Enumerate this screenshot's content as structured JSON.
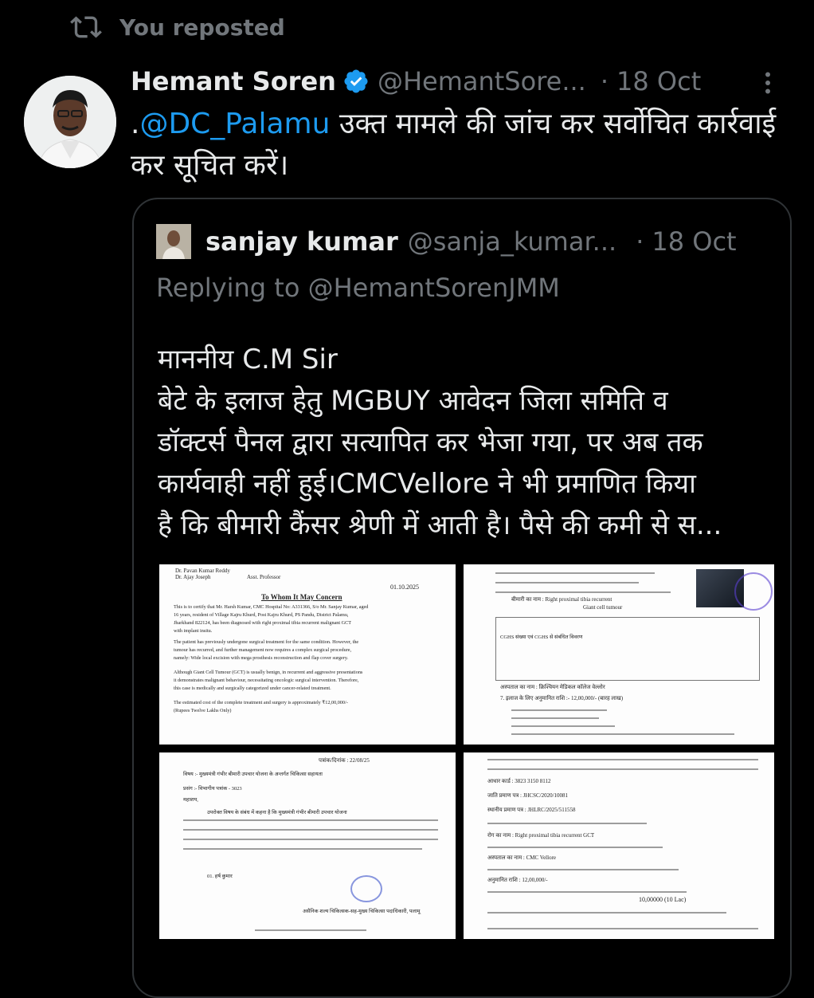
{
  "repost": {
    "label": "You reposted",
    "icon": "repost-icon"
  },
  "tweet": {
    "author_name": "Hemant Soren",
    "handle": "@HemantSore...",
    "separator": "·",
    "time": "18 Oct",
    "text_line1_prefix": ".",
    "mention": "@DC_Palamu",
    "text_line1_rest": " उक्त मामले की जांच कर सर्वोचित कार्रवाई",
    "text_line2": "कर सूचित करें।"
  },
  "quote": {
    "author_name": "sanjay kumar",
    "handle": "@sanja_kumar...",
    "separator": "·",
    "time": "18 Oct",
    "replying_to": "Replying to @HemantSorenJMM",
    "body": "माननीय C.M Sir\nबेटे के इलाज हेतु MGBUY आवेदन जिला समिति व\nडॉक्टर्स पैनल द्वारा सत्यापित कर भेजा गया, पर अब तक\nकार्यवाही नहीं हुई।CMCVellore ने भी प्रमाणित किया\nहै कि बीमारी कैंसर श्रेणी में आती है। पैसे की कमी से स..."
  },
  "doc1": {
    "date": "01.10.2025",
    "heading": "To Whom It May Concern",
    "l1": "This is to certify that Mr. Harsh Kumar, CMC Hospital No: A331366, S/o Mr. Sanjay Kumar, aged",
    "l2": "16 years, resident of Village Kajru Khurd, Post Kajru Khurd, PS Pandu, District Palamu,",
    "l3": "Jharkhand 822124, has been diagnosed with right proximal tibia recurrent malignant GCT",
    "l4": "with implant insitu.",
    "l5": "The patient has previously undergone surgical treatment for the same condition. However, the",
    "l6": "tumour has recurred, and further management now requires a complex surgical procedure,",
    "l7": "namely: Wide local excision with mega prosthesis reconstruction and flap cover surgery.",
    "l8": "Although Giant Cell Tumour (GCT) is usually benign, in recurrent and aggressive presentations",
    "l9": "it demonstrates malignant behaviour, necessitating oncologic surgical intervention. Therefore,",
    "l10": "this case is medically and surgically categorized under cancer-related treatment.",
    "l11": "The estimated cost of the complete treatment and surgery is approximately ₹12,00,000/-",
    "l12": "(Rupees Twelve Lakhs Only)",
    "h1": "Dr. Pavan Kumar Reddy",
    "h2": "Dr. Ajay Joseph",
    "h3": "Asst. Professor"
  },
  "doc2": {
    "l1": "बीमारी का नाम : Right proximal tibia recurrent",
    "l2": "Giant cell tumour",
    "l3": "CGHS संख्या एवं CGHS से संबंधित विवरण",
    "l4": "7. इलाज के लिए अनुमानित राशि :- 12,00,000/- (बारह लाख)",
    "l5": "अस्पताल का नाम : क्रिश्चियन मेडिकल कॉलेज वेल्लोर"
  },
  "doc3": {
    "l1": "पत्रांक/दिनांक : 22/08/25",
    "l2": "विषय :- मुख्यमंत्री गंभीर बीमारी उपचार योजना के अन्तर्गत चिकित्सा सहायता",
    "l3": "प्रसंग :- विभागीय पत्रांक - 3023",
    "l4": "महाशय,",
    "l5": "उपरोक्त विषय के संबंध में कहना है कि मुख्यमंत्री गंभीर बीमारी उपचार योजना",
    "l6": "01. हर्ष कुमार",
    "l7": "असैनिक शल्य चिकित्सक-सह-मुख्य चिकित्सा पदाधिकारी, पलामू"
  },
  "doc4": {
    "l1": "आधार कार्ड : 3823 3150 8112",
    "l2": "जाति प्रमाण पत्र : JHCSC/2020/10081",
    "l3": "स्थानीय प्रमाण पत्र : JHLRC/2025/511558",
    "l4": "रोग का नाम : Right proximal tibia recurrent GCT",
    "l5": "अस्पताल का नाम : CMC Vellore",
    "l6": "अनुमानित राशि : 12,00,000/-",
    "l7": "10,00000 (10 Lac)"
  }
}
